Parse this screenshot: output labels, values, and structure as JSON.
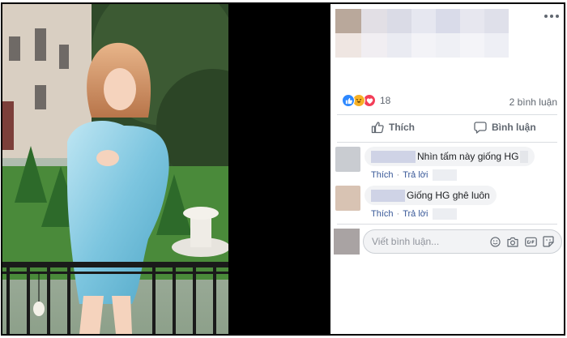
{
  "post": {
    "reaction_count": "18",
    "comment_count": "2 bình luận",
    "like_label": "Thích",
    "comment_label": "Bình luận"
  },
  "comments": [
    {
      "text": "Nhìn tấm này giống HG",
      "like": "Thích",
      "reply": "Trả lời",
      "avatar_color": "#c9ccd1"
    },
    {
      "text": "Giống HG ghê luôn",
      "like": "Thích",
      "reply": "Trả lời",
      "avatar_color": "#d8c3b3"
    }
  ],
  "composer": {
    "placeholder": "Viết bình luận...",
    "icons": [
      "emoji-icon",
      "camera-icon",
      "gif-icon",
      "sticker-icon"
    ]
  },
  "colors": {
    "link": "#385898",
    "muted": "#606770",
    "like_blue": "#2d88ff",
    "love_red": "#f33e58",
    "haha_yellow": "#f7b125"
  }
}
